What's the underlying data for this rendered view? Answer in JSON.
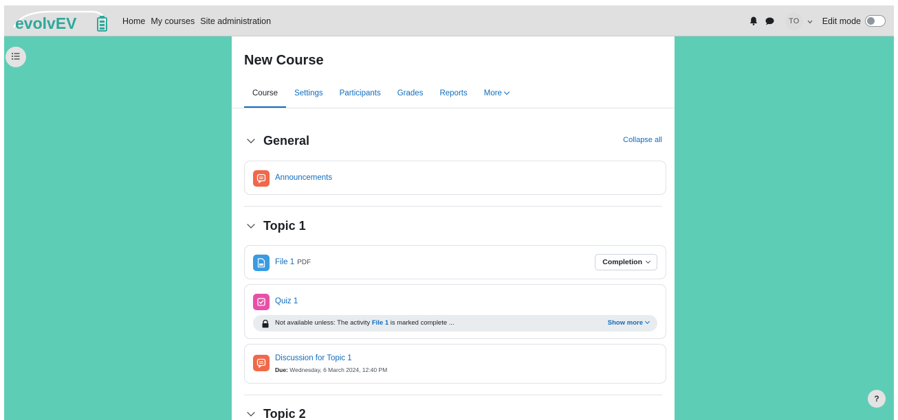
{
  "brand": {
    "logo_text": "evolvEV",
    "accent": "#2ea89b"
  },
  "nav": {
    "links": [
      "Home",
      "My courses",
      "Site administration"
    ],
    "user_initials": "TO",
    "edit_mode_label": "Edit mode"
  },
  "course": {
    "title": "New Course",
    "tabs": [
      "Course",
      "Settings",
      "Participants",
      "Grades",
      "Reports",
      "More"
    ]
  },
  "general": {
    "title": "General",
    "collapse_all": "Collapse all",
    "activities": [
      {
        "name": "Announcements",
        "icon": "forum-icon"
      }
    ]
  },
  "topic1": {
    "title": "Topic 1",
    "file": {
      "name": "File 1",
      "type": "PDF",
      "completion_label": "Completion"
    },
    "quiz": {
      "name": "Quiz 1",
      "restriction_prefix": "Not available unless: The activity",
      "restriction_link": "File 1",
      "restriction_suffix": "is marked complete ...",
      "show_more": "Show more"
    },
    "discussion": {
      "name": "Discussion for Topic 1",
      "due_label": "Due:",
      "due_value": "Wednesday, 6 March 2024, 12:40 PM"
    }
  },
  "topic2": {
    "title": "Topic 2"
  },
  "colors": {
    "background": "#5ecdb6",
    "link": "#0f6cbf",
    "forum_icon": "#f0694a",
    "file_icon": "#399be2",
    "quiz_icon": "#e850a8"
  },
  "help_label": "?"
}
